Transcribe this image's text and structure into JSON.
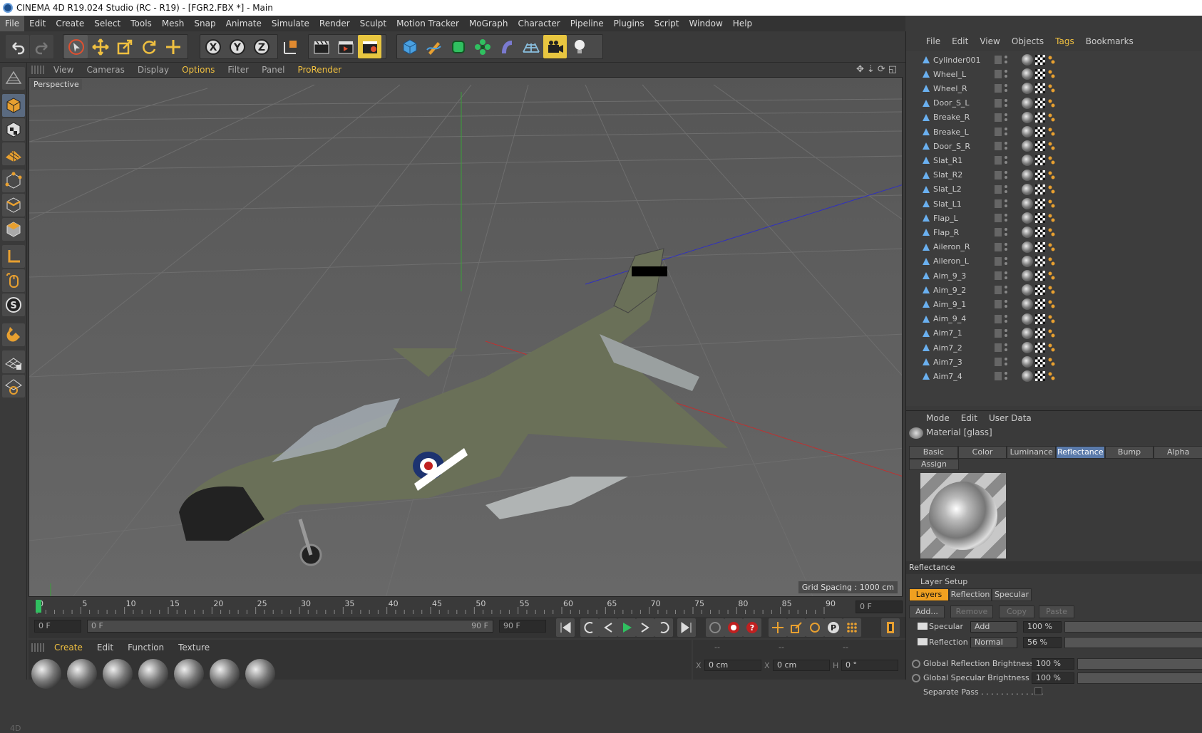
{
  "title": "CINEMA 4D R19.024 Studio (RC - R19) - [FGR2.FBX *] - Main",
  "menu": [
    "File",
    "Edit",
    "Create",
    "Select",
    "Tools",
    "Mesh",
    "Snap",
    "Animate",
    "Simulate",
    "Render",
    "Sculpt",
    "Motion Tracker",
    "MoGraph",
    "Character",
    "Pipeline",
    "Plugins",
    "Script",
    "Window",
    "Help"
  ],
  "viewport_menu": [
    "View",
    "Cameras",
    "Display",
    "Options",
    "Filter",
    "Panel",
    "ProRender"
  ],
  "viewport": {
    "label": "Perspective",
    "grid_spacing": "Grid Spacing : 1000 cm"
  },
  "timeline": {
    "ticks": [
      "0",
      "5",
      "10",
      "15",
      "20",
      "25",
      "30",
      "35",
      "40",
      "45",
      "50",
      "55",
      "60",
      "65",
      "70",
      "75",
      "80",
      "85",
      "90"
    ],
    "end_field": "0 F"
  },
  "frames": {
    "start": "0 F",
    "slider_start": "0 F",
    "slider_end": "90 F",
    "end": "90 F"
  },
  "material_menu": [
    "Create",
    "Edit",
    "Function",
    "Texture"
  ],
  "coords": {
    "x1": "0 cm",
    "x2": "0 cm",
    "h": "0 °",
    "dash1": "--",
    "dash2": "--",
    "dash3": "--"
  },
  "object_manager": {
    "menu": [
      "File",
      "Edit",
      "View",
      "Objects",
      "Tags",
      "Bookmarks"
    ],
    "objects": [
      "Cylinder001",
      "Wheel_L",
      "Wheel_R",
      "Door_S_L",
      "Breake_R",
      "Breake_L",
      "Door_S_R",
      "Slat_R1",
      "Slat_R2",
      "Slat_L2",
      "Slat_L1",
      "Flap_L",
      "Flap_R",
      "Aileron_R",
      "Aileron_L",
      "Aim_9_3",
      "Aim_9_2",
      "Aim_9_1",
      "Aim_9_4",
      "Aim7_1",
      "Aim7_2",
      "Aim7_3",
      "Aim7_4"
    ]
  },
  "attribute_manager": {
    "menu": [
      "Mode",
      "Edit",
      "User Data"
    ],
    "material_title": "Material [glass]",
    "tabs": [
      "Basic",
      "Color",
      "Luminance",
      "Reflectance",
      "Bump",
      "Alpha"
    ],
    "assign": "Assign",
    "section": "Reflectance",
    "layer_setup": "Layer Setup",
    "layer_tabs": [
      "Layers",
      "Reflection",
      "Specular"
    ],
    "buttons": [
      "Add...",
      "Remove",
      "Copy",
      "Paste"
    ],
    "specular": {
      "label": "Specular",
      "mode": "Add",
      "value": "100 %"
    },
    "reflection": {
      "label": "Reflection",
      "mode": "Normal",
      "value": "56 %"
    },
    "global_reflection": {
      "label": "Global Reflection Brightness",
      "value": "100 %"
    },
    "global_specular": {
      "label": "Global Specular Brightness",
      "value": "100 %"
    },
    "separate_pass": "Separate Pass . . . . . . . . . . . . ."
  },
  "side_label": "4D",
  "colors": {
    "accent": "#f0c040",
    "active_tab": "#5a7aaa",
    "orange_button": "#f0a020"
  }
}
